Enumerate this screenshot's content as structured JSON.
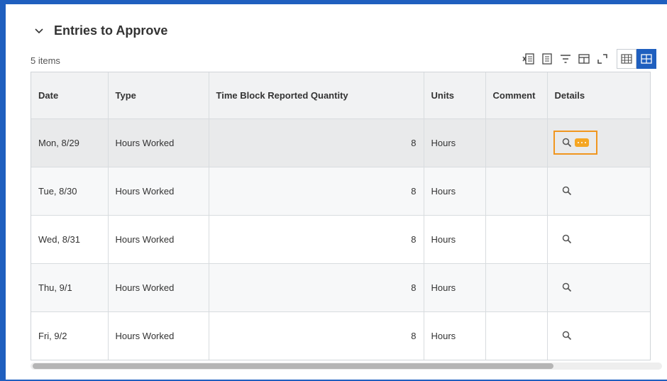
{
  "section": {
    "title": "Entries to Approve",
    "item_count": "5 items"
  },
  "toolbar": {
    "icons": [
      "export-excel-icon",
      "print-icon",
      "filter-icon",
      "column-layout-icon",
      "fullscreen-icon"
    ],
    "views": [
      "table-view-icon",
      "grid-view-icon"
    ],
    "active_view": "grid-view-icon"
  },
  "table": {
    "columns": [
      "Date",
      "Type",
      "Time Block Reported Quantity",
      "Units",
      "Comment",
      "Details"
    ],
    "rows": [
      {
        "date": "Mon, 8/29",
        "type": "Hours Worked",
        "qty": "8",
        "units": "Hours",
        "comment": ""
      },
      {
        "date": "Tue, 8/30",
        "type": "Hours Worked",
        "qty": "8",
        "units": "Hours",
        "comment": ""
      },
      {
        "date": "Wed, 8/31",
        "type": "Hours Worked",
        "qty": "8",
        "units": "Hours",
        "comment": ""
      },
      {
        "date": "Thu, 9/1",
        "type": "Hours Worked",
        "qty": "8",
        "units": "Hours",
        "comment": ""
      },
      {
        "date": "Fri, 9/2",
        "type": "Hours Worked",
        "qty": "8",
        "units": "Hours",
        "comment": ""
      }
    ]
  },
  "colors": {
    "frame_border": "#1f5fbf",
    "active_view": "#1f5fbf",
    "focus_outline": "#f0961f",
    "more_button": "#f5a623"
  }
}
